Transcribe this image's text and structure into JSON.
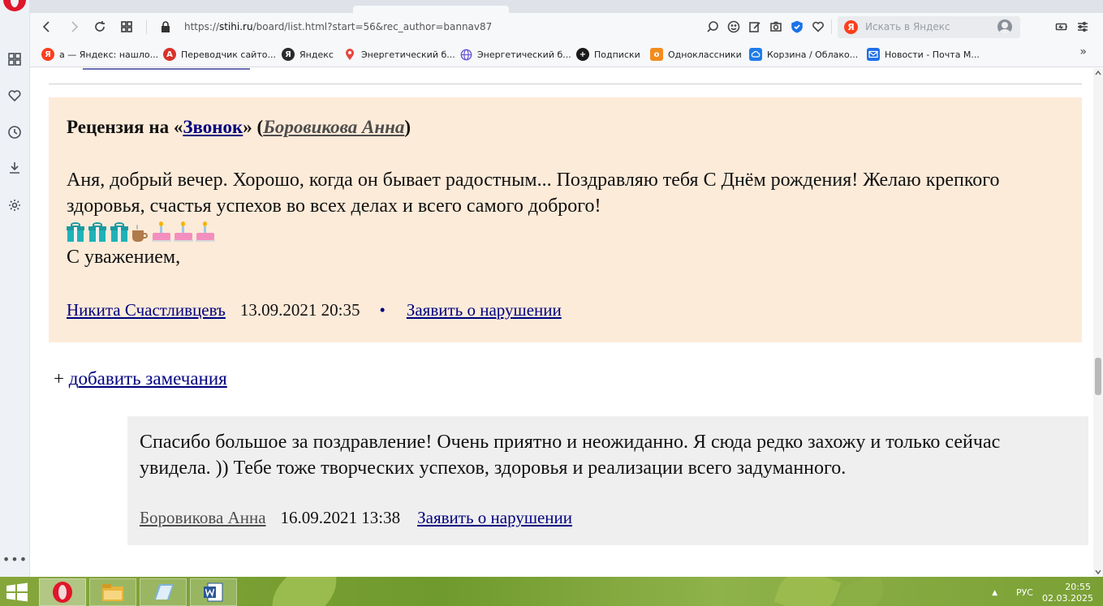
{
  "browser": {
    "url_prefix": "https://",
    "url_domain": "stihi.ru",
    "url_rest": "/board/list.html?start=56&rec_author=bannav87",
    "search_placeholder": "Искать в Яндекс",
    "yandex_letter": "Я"
  },
  "bookmarks": [
    {
      "label": "а — Яндекс: нашло...",
      "icon_color": "#fc3f1d",
      "glyph": "Я"
    },
    {
      "label": "Переводчик сайто...",
      "icon_color": "#d8342a",
      "glyph": "A"
    },
    {
      "label": "Яндекс",
      "icon_color": "#2b2b2b",
      "glyph": "Я"
    },
    {
      "label": "Энергетический б...",
      "icon_color": "#e8453c",
      "glyph": ""
    },
    {
      "label": "Энергетический б...",
      "icon_color": "#6a55d8",
      "glyph": ""
    },
    {
      "label": "Подписки",
      "icon_color": "#1a1a1a",
      "glyph": "+"
    },
    {
      "label": "Одноклассники",
      "icon_color": "#f28c1e",
      "glyph": "о"
    },
    {
      "label": "Корзина / Облако...",
      "icon_color": "#1e7ce8",
      "glyph": ""
    },
    {
      "label": "Новости - Почта М...",
      "icon_color": "#1e6fe8",
      "glyph": "@"
    }
  ],
  "bookmarks_more": "»",
  "review": {
    "title_prefix": "Рецензия на «",
    "work_title": "Звонок",
    "title_middle": "» (",
    "author": "Боровикова Анна",
    "title_suffix": ")",
    "text": "Аня, добрый вечер. Хорошо, когда он бывает радостным... Поздравляю тебя С Днём рождения! Желаю крепкого здоровья, счастья успехов во всех делах и всего самого доброго!",
    "signature": "С уважением,",
    "reviewer": "Никита Счастливцевъ",
    "date": "13.09.2021 20:35",
    "separator": "•",
    "report": "Заявить о нарушении",
    "emoji_icons": [
      "gift-icon",
      "gift-icon",
      "gift-icon",
      "coffee-icon",
      "cake-icon",
      "cake-icon",
      "cake-icon"
    ]
  },
  "add_note": {
    "plus": "+ ",
    "first_letter": "д",
    "link_rest": "обавить замечания"
  },
  "reply": {
    "text": "Спасибо большое за поздравление! Очень приятно и неожиданно. Я сюда редко захожу и только сейчас увидела. )) Тебе тоже творческих успехов, здоровья и реализации всего задуманного.",
    "author": "Боровикова Анна",
    "date": "16.09.2021 13:38",
    "report": "Заявить о нарушении"
  },
  "taskbar": {
    "lang": "РУС",
    "time": "20:55",
    "date": "02.03.2025",
    "tray_arrow": "▲"
  },
  "colors": {
    "review_bg": "#fdebd9",
    "reply_bg": "#efefef",
    "link": "#000080",
    "opera_red": "#e0162b"
  }
}
